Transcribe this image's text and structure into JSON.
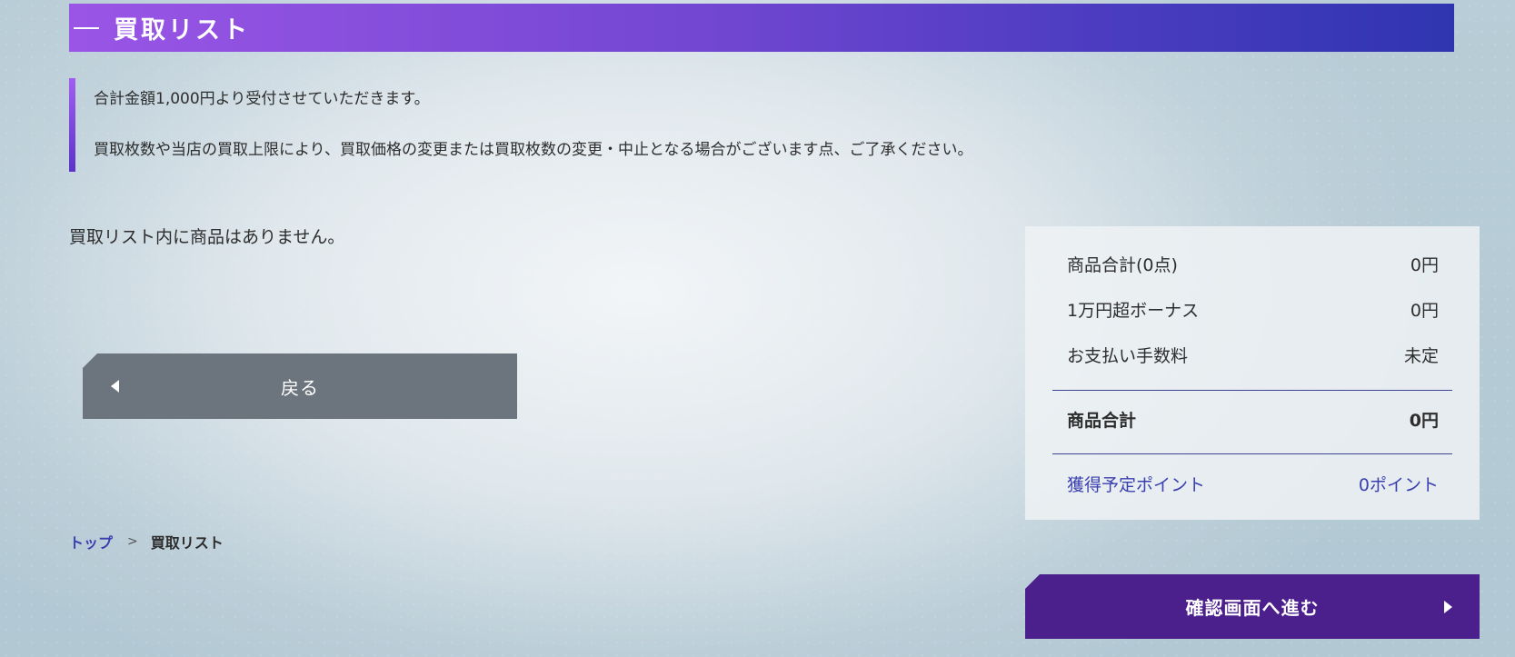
{
  "header": {
    "title": "買取リスト"
  },
  "notice": {
    "line1": "合計金額1,000円より受付させていただきます。",
    "line2": "買取枚数や当店の買取上限により、買取価格の変更または買取枚数の変更・中止となる場合がございます点、ご了承ください。"
  },
  "main": {
    "empty_message": "買取リスト内に商品はありません。",
    "back_label": "戻る"
  },
  "breadcrumb": {
    "items": [
      "トップ",
      "買取リスト"
    ]
  },
  "summary": {
    "rows": [
      {
        "label": "商品合計(0点)",
        "value": "0円"
      },
      {
        "label": "1万円超ボーナス",
        "value": "0円"
      },
      {
        "label": "お支払い手数料",
        "value": "未定"
      }
    ],
    "total": {
      "label": "商品合計",
      "value": "0円"
    },
    "points": {
      "label": "獲得予定ポイント",
      "value": "0ポイント"
    }
  },
  "actions": {
    "next_label": "確認画面へ進む"
  },
  "colors": {
    "accent_start": "#9a55e6",
    "accent_end": "#2f35b0",
    "button_dark": "#6c747d",
    "button_primary": "#4b1f8c",
    "link": "#3a3fb0"
  }
}
